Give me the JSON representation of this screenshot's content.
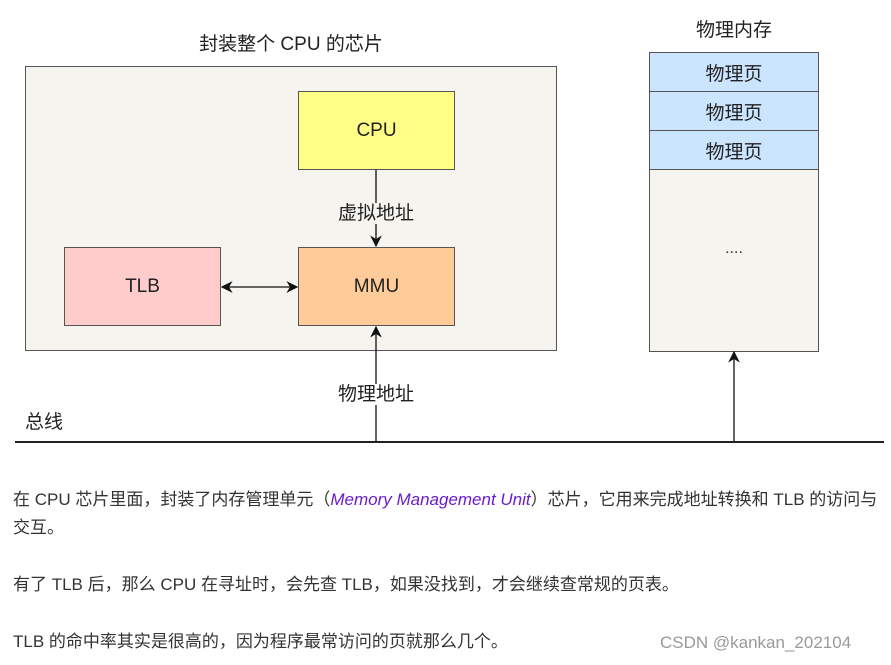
{
  "diagram": {
    "chip_title": "封装整个 CPU 的芯片",
    "memory_title": "物理内存",
    "nodes": {
      "cpu": "CPU",
      "tlb": "TLB",
      "mmu": "MMU"
    },
    "memory_pages": [
      "物理页",
      "物理页",
      "物理页"
    ],
    "memory_ellipsis": "....",
    "edges": {
      "cpu_to_mmu": "虚拟地址",
      "bus_to_mmu": "物理地址"
    },
    "bus_label": "总线",
    "colors": {
      "chip_fill": "#f6f4ee",
      "cpu_fill": "#ffff88",
      "tlb_fill": "#ffcccc",
      "mmu_fill": "#ffcc99",
      "page_fill": "#cce5ff",
      "stroke": "#555555"
    }
  },
  "article": {
    "p1_before": "在 CPU 芯片里面，封装了内存管理单元（",
    "p1_term": "Memory Management Unit",
    "p1_after": "）芯片，它用来完成地址转换和 TLB 的访问与交互。",
    "p2": "有了 TLB 后，那么 CPU 在寻址时，会先查 TLB，如果没找到，才会继续查常规的页表。",
    "p3": "TLB 的命中率其实是很高的，因为程序最常访问的页就那么几个。",
    "link_color": "#6a1ccf"
  },
  "watermark": "CSDN @kankan_202104"
}
